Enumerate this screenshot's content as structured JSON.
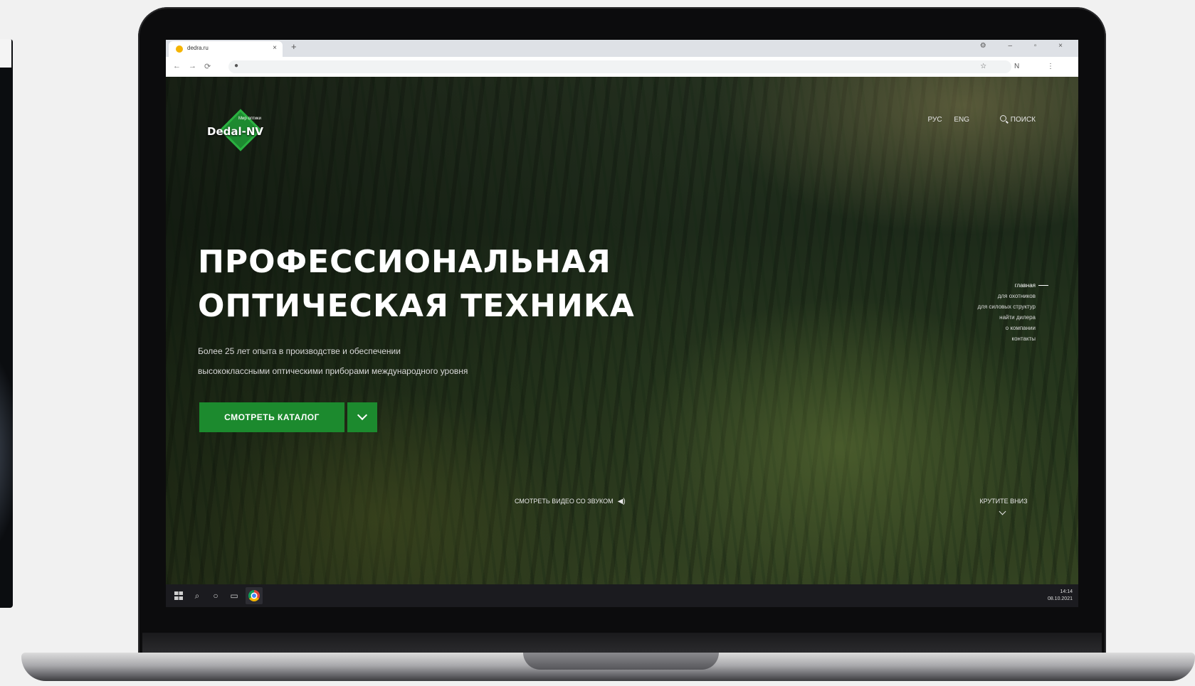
{
  "browser": {
    "tab_title": "dedra.ru",
    "tab_close": "×",
    "new_tab": "+",
    "window_controls": "⚙ – ▫ ×",
    "nav_back": "←",
    "nav_forward": "→",
    "nav_reload": "⟳",
    "address_right": "☆ N ⋮"
  },
  "header": {
    "logo_text": "Dedal-NV",
    "logo_tagline": "Мир оптики",
    "lang_ru": "РУС",
    "lang_en": "ENG",
    "search_label": "ПОИСК"
  },
  "hero": {
    "title_line1": "ПРОФЕССИОНАЛЬНАЯ",
    "title_line2": "ОПТИЧЕСКАЯ ТЕХНИКА",
    "subtitle_line1": "Более 25 лет опыта в производстве и обеспечении",
    "subtitle_line2": "высококлассными оптическими приборами международного уровня",
    "catalog_button": "СМОТРЕТЬ КАТАЛОГ"
  },
  "sidenav": {
    "items": [
      "главная",
      "для охотников",
      "для силовых структур",
      "найти дилера",
      "о компании",
      "контакты"
    ]
  },
  "footer_links": {
    "video": "СМОТРЕТЬ ВИДЕО СО ЗВУКОМ",
    "scroll": "КРУТИТЕ ВНИЗ"
  },
  "taskbar": {
    "search": "⌕",
    "cortana": "○",
    "taskview": "▭",
    "time": "14:14",
    "date": "08.10.2021"
  },
  "colors": {
    "accent_green": "#1c8a2e",
    "taskbar": "#1b1b1f"
  }
}
